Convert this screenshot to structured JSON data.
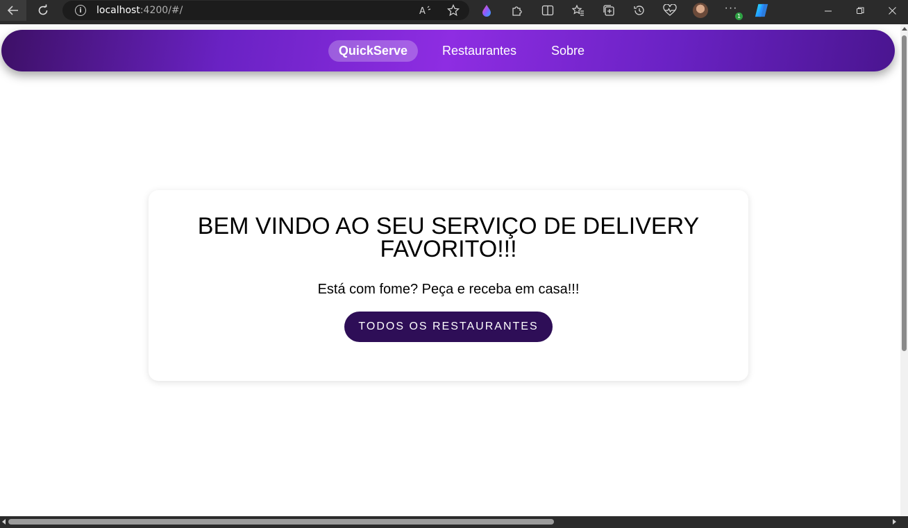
{
  "browser": {
    "url_host": "localhost",
    "url_rest": ":4200/#/",
    "extension_badge": "1",
    "icons": {
      "back": "arrow-left-icon",
      "reload": "reload-icon",
      "info": "info-icon",
      "read_aloud": "read-aloud-icon",
      "favorite": "star-icon",
      "extension_drop": "drop-extension-icon",
      "extensions": "puzzle-icon",
      "split_screen": "split-screen-icon",
      "favorites": "favorites-icon",
      "collections": "collections-icon",
      "history": "history-icon",
      "performance": "heart-pulse-icon",
      "profile": "avatar",
      "more": "more-icon",
      "copilot": "copilot-icon",
      "minimize": "minimize-icon",
      "restore": "restore-icon",
      "close": "close-icon"
    }
  },
  "nav": {
    "brand": "QuickServe",
    "links": [
      "Restaurantes",
      "Sobre"
    ]
  },
  "hero": {
    "title": "BEM VINDO AO SEU SERVIÇO DE DELIVERY FAVORITO!!!",
    "subtitle": "Está com fome? Peça e receba em casa!!!",
    "button": "TODOS OS RESTAURANTES"
  },
  "colors": {
    "nav_gradient_start": "#3d1066",
    "nav_gradient_mid": "#8e2de2",
    "button_bg": "#2e0e57",
    "chrome_bg": "#2b2b2b"
  }
}
